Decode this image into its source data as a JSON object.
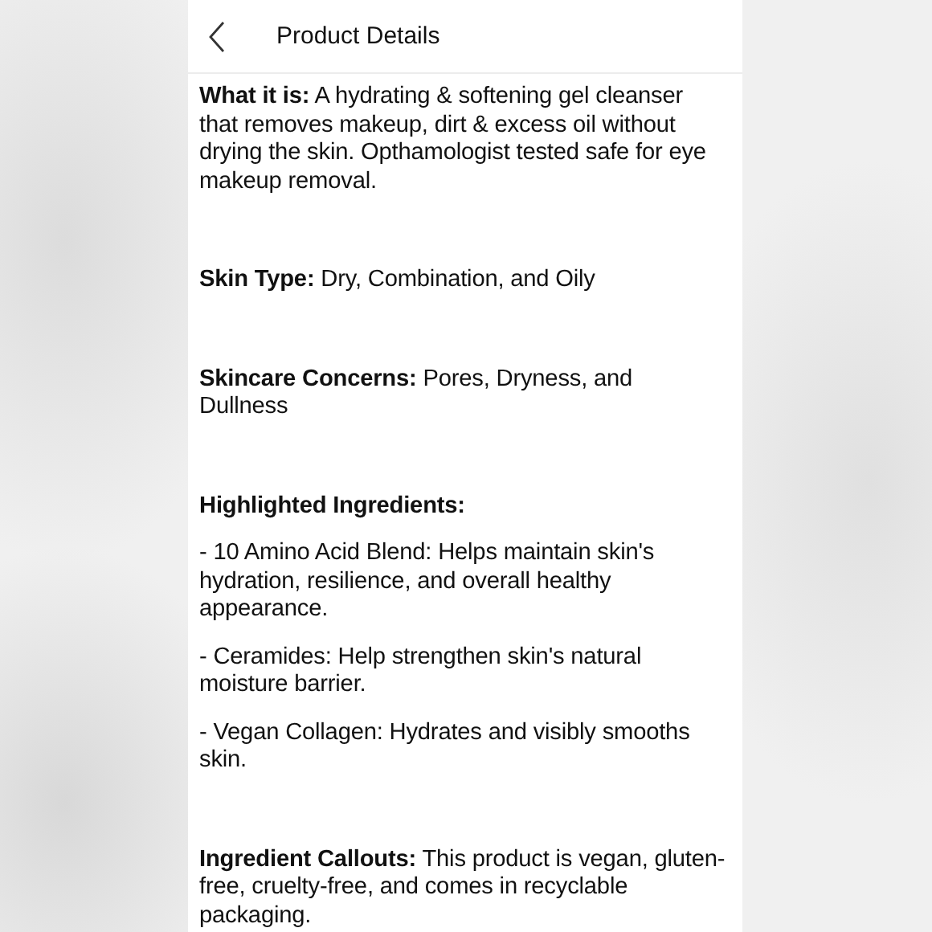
{
  "header": {
    "title": "Product Details"
  },
  "sections": [
    {
      "text": "**What it is:** A hydrating & softening gel cleanser that removes makeup, dirt & excess oil without drying the skin. Opthamologist tested safe for eye makeup removal."
    },
    {
      "text": "**Skin Type:** Dry, Combination, and Oily"
    },
    {
      "text": "**Skincare Concerns:** Pores, Dryness, and Dullness"
    },
    {
      "text": "**Highlighted Ingredients:**",
      "items": [
        "- 10 Amino Acid Blend: Helps maintain skin's hydration, resilience, and overall healthy appearance.",
        "- Ceramides: Help strengthen skin's natural moisture barrier.",
        "- Vegan Collagen: Hydrates and visibly smooths skin."
      ]
    },
    {
      "text": "**Ingredient Callouts:** This product is vegan, gluten-free, cruelty-free, and comes in recyclable packaging."
    }
  ]
}
